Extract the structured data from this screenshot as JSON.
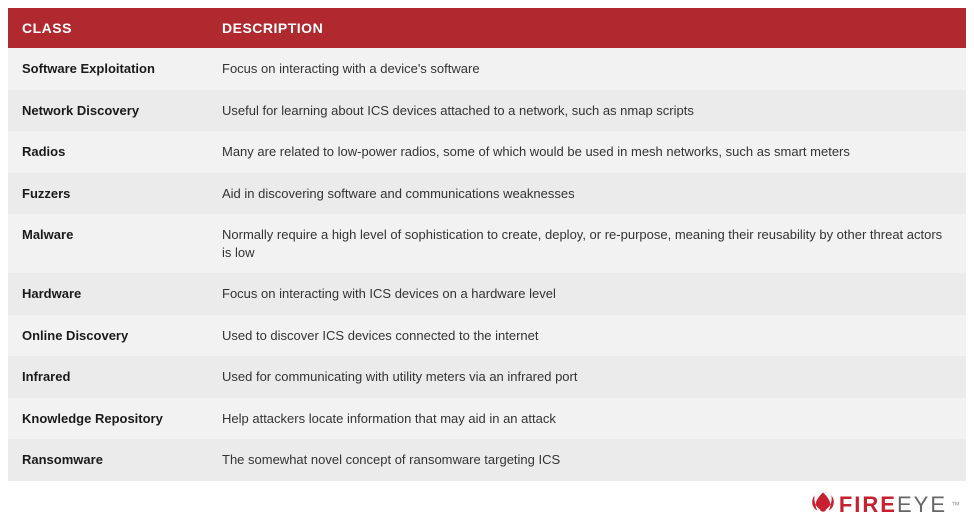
{
  "table": {
    "headers": {
      "class": "CLASS",
      "description": "DESCRIPTION"
    },
    "rows": [
      {
        "class": "Software Exploitation",
        "description": "Focus on interacting with a device's software"
      },
      {
        "class": "Network Discovery",
        "description": "Useful for learning about ICS devices attached to a network, such as nmap scripts"
      },
      {
        "class": "Radios",
        "description": "Many are related to low-power radios, some of which would be used in mesh networks, such as smart meters"
      },
      {
        "class": "Fuzzers",
        "description": "Aid in discovering software and communications weaknesses"
      },
      {
        "class": "Malware",
        "description": "Normally require a high level of sophistication to create, deploy, or re-purpose, meaning their reusability by other threat actors is low"
      },
      {
        "class": "Hardware",
        "description": "Focus on interacting with ICS devices on a hardware level"
      },
      {
        "class": "Online Discovery",
        "description": "Used to discover ICS devices connected to the internet"
      },
      {
        "class": "Infrared",
        "description": "Used for communicating with utility meters via an infrared port"
      },
      {
        "class": "Knowledge Repository",
        "description": "Help attackers locate information that may aid in an attack"
      },
      {
        "class": "Ransomware",
        "description": "The somewhat novel concept of ransomware targeting ICS"
      }
    ]
  },
  "logo": {
    "accent": "FIRE",
    "rest": "EYE",
    "tm": "™"
  },
  "colors": {
    "header_bg": "#af292e",
    "accent": "#c8202f"
  }
}
